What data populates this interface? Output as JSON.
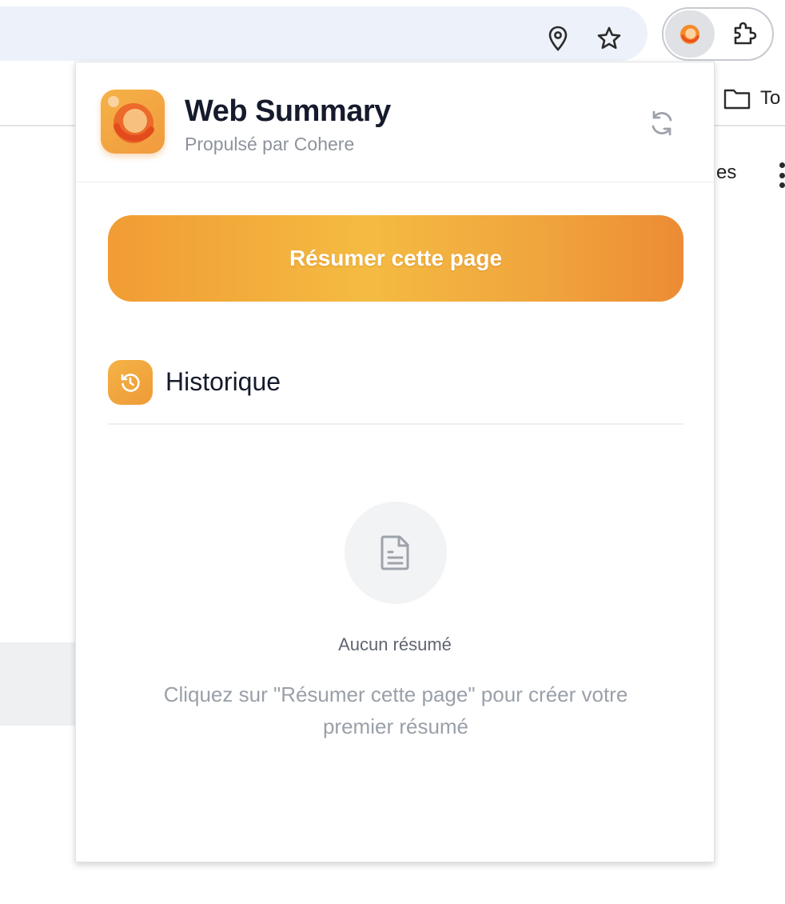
{
  "browser": {
    "bookmark_folder_label": "To",
    "background_text": "es"
  },
  "popup": {
    "app_title": "Web Summary",
    "app_subtitle": "Propulsé par Cohere",
    "summarize_button_label": "Résumer cette page",
    "history_title": "Historique",
    "empty_state": {
      "title": "Aucun résumé",
      "description": "Cliquez sur \"Résumer cette page\" pour créer votre premier résumé"
    }
  },
  "colors": {
    "accent_orange": "#f19c34",
    "accent_yellow": "#f4bb42",
    "title_text": "#151b2c",
    "muted_text": "#9aa0a9"
  },
  "icons": {
    "omnibox": [
      "location-pin-icon",
      "bookmark-star-icon"
    ],
    "toolbar": [
      "web-summary-extension-icon",
      "extensions-puzzle-icon"
    ],
    "popup": [
      "app-logo-icon",
      "refresh-icon",
      "history-icon",
      "document-icon"
    ]
  }
}
